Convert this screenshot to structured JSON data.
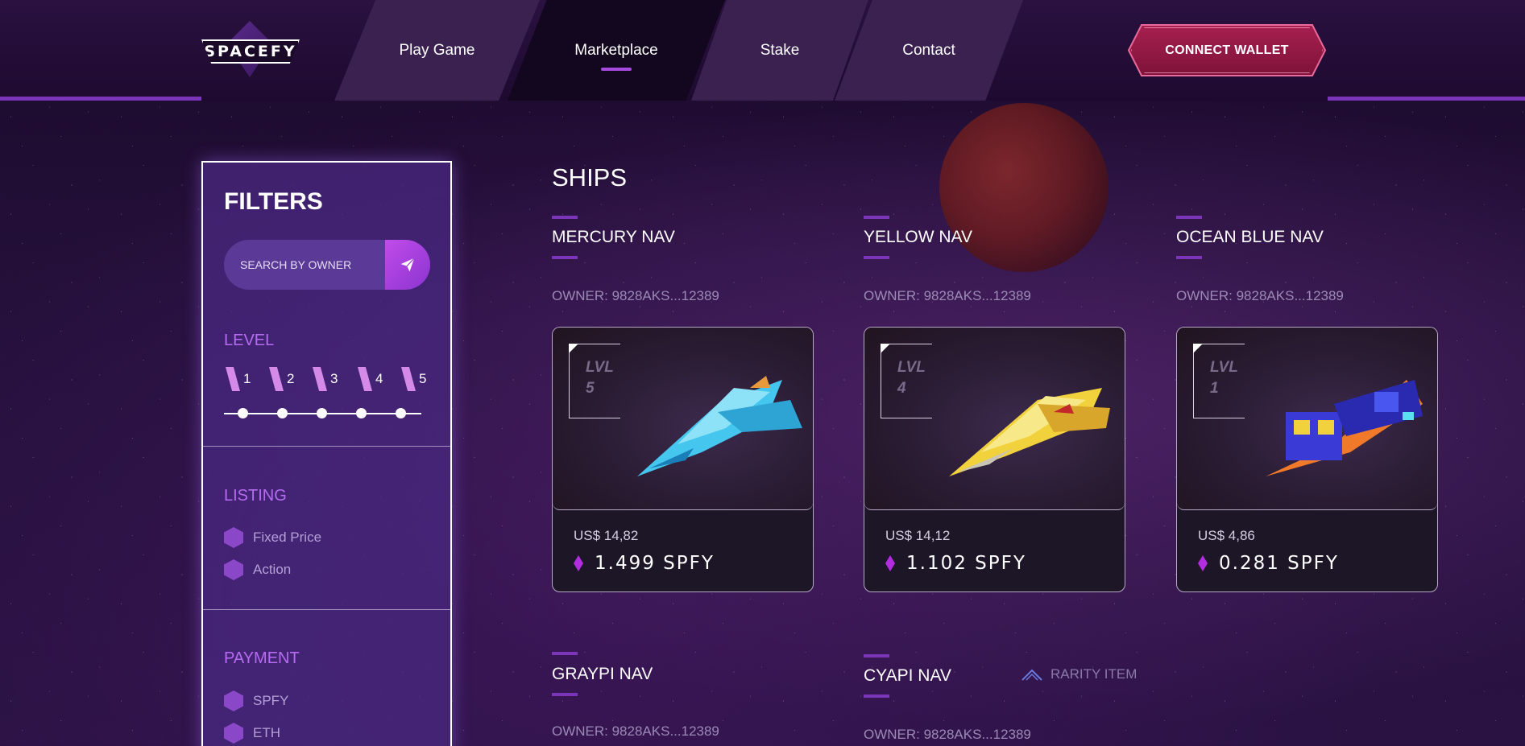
{
  "brand": {
    "logo_text": "SPACEFY"
  },
  "nav": {
    "tabs": [
      {
        "label": "Play Game"
      },
      {
        "label": "Marketplace",
        "active": true
      },
      {
        "label": "Stake"
      },
      {
        "label": "Contact"
      }
    ],
    "wallet_button": "CONNECT WALLET"
  },
  "filters": {
    "title": "FILTERS",
    "search_placeholder": "SEARCH BY OWNER",
    "level": {
      "label": "LEVEL",
      "values": [
        "1",
        "2",
        "3",
        "4",
        "5"
      ]
    },
    "listing": {
      "label": "LISTING",
      "options": [
        "Fixed Price",
        "Action"
      ]
    },
    "payment": {
      "label": "PAYMENT",
      "options": [
        "SPFY",
        "ETH"
      ]
    }
  },
  "main": {
    "title": "SHIPS",
    "cards": [
      {
        "name": "MERCURY NAV",
        "owner": "OWNER: 9828AKS...12389",
        "level_text": "LVL",
        "level": "5",
        "usd": "US$ 14,82",
        "spfy": "1.499 SPFY",
        "ship_color": "#45c6ee"
      },
      {
        "name": "YELLOW NAV",
        "owner": "OWNER: 9828AKS...12389",
        "level_text": "LVL",
        "level": "4",
        "usd": "US$ 14,12",
        "spfy": "1.102 SPFY",
        "ship_color": "#f2d23c"
      },
      {
        "name": "OCEAN BLUE NAV",
        "owner": "OWNER: 9828AKS...12389",
        "level_text": "LVL",
        "level": "1",
        "usd": "US$ 4,86",
        "spfy": "0.281 SPFY",
        "ship_color": "#3a3ad6"
      }
    ],
    "row2": [
      {
        "name": "GRAYPI NAV",
        "owner": "OWNER: 9828AKS...12389"
      },
      {
        "name": "CYAPI NAV",
        "owner": "OWNER: 9828AKS...12389"
      }
    ],
    "rarity_label": "RARITY ITEM"
  },
  "colors": {
    "accent": "#7a35b8",
    "wallet": "#a8204f",
    "gem": "#b22de0"
  }
}
